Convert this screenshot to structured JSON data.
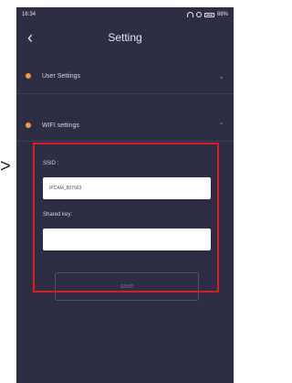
{
  "status_bar": {
    "time": "16:34",
    "battery": "88%"
  },
  "header": {
    "title": "Setting",
    "back_icon": "back-chevron-icon"
  },
  "sections": [
    {
      "label": "User Settings",
      "expanded": false
    },
    {
      "label": "WIFI settings",
      "expanded": true
    }
  ],
  "wifi": {
    "ssid_label": "SSID :",
    "ssid_value": "IPCAM_807663",
    "key_label": "Shared key:",
    "key_value": "",
    "save_label": "save"
  },
  "colors": {
    "background": "#2d2d45",
    "accent_dot": "#f0a030",
    "highlight_border": "#e11b22"
  }
}
